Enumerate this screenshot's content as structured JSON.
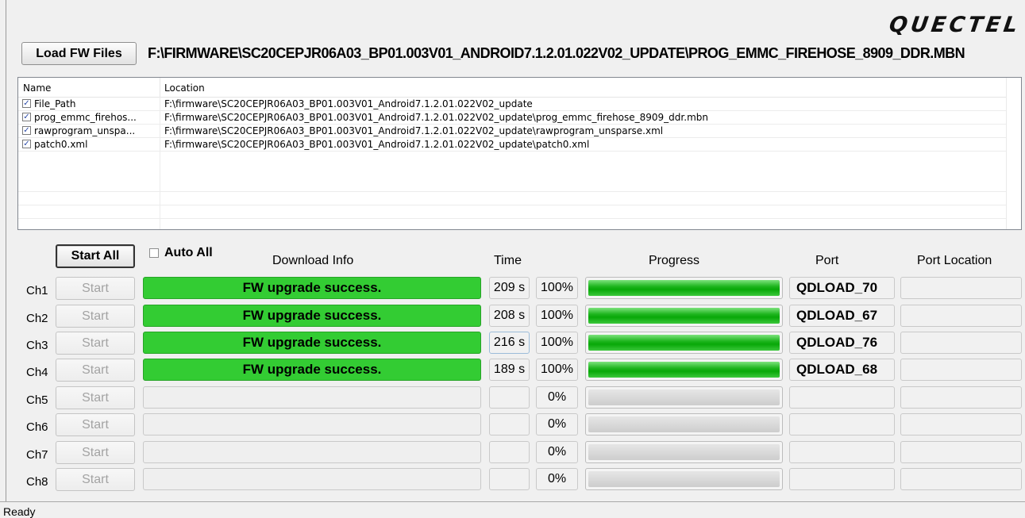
{
  "brand": {
    "logo_text": "QUECTEL"
  },
  "toolbar": {
    "load_label": "Load FW Files",
    "fw_path": "F:\\FIRMWARE\\SC20CEPJR06A03_BP01.003V01_ANDROID7.1.2.01.022V02_UPDATE\\PROG_EMMC_FIREHOSE_8909_DDR.MBN"
  },
  "file_list": {
    "columns": [
      "Name",
      "Location"
    ],
    "rows": [
      {
        "checked": true,
        "name": "File_Path",
        "location": "F:\\firmware\\SC20CEPJR06A03_BP01.003V01_Android7.1.2.01.022V02_update"
      },
      {
        "checked": true,
        "name": "prog_emmc_firehos...",
        "location": "F:\\firmware\\SC20CEPJR06A03_BP01.003V01_Android7.1.2.01.022V02_update\\prog_emmc_firehose_8909_ddr.mbn"
      },
      {
        "checked": true,
        "name": "rawprogram_unspa...",
        "location": "F:\\firmware\\SC20CEPJR06A03_BP01.003V01_Android7.1.2.01.022V02_update\\rawprogram_unsparse.xml"
      },
      {
        "checked": true,
        "name": "patch0.xml",
        "location": "F:\\firmware\\SC20CEPJR06A03_BP01.003V01_Android7.1.2.01.022V02_update\\patch0.xml"
      }
    ]
  },
  "controls": {
    "start_all_label": "Start All",
    "auto_all_label": "Auto All",
    "auto_all_checked": false
  },
  "headers": {
    "download_info": "Download Info",
    "time": "Time",
    "progress": "Progress",
    "port": "Port",
    "port_location": "Port Location"
  },
  "channels": [
    {
      "label": "Ch1",
      "button": "Start",
      "info": "FW upgrade success.",
      "time": "209 s",
      "percent": "100%",
      "progress": 1.0,
      "port": "QDLOAD_70",
      "port_location": ""
    },
    {
      "label": "Ch2",
      "button": "Start",
      "info": "FW upgrade success.",
      "time": "208 s",
      "percent": "100%",
      "progress": 1.0,
      "port": "QDLOAD_67",
      "port_location": ""
    },
    {
      "label": "Ch3",
      "button": "Start",
      "info": "FW upgrade success.",
      "time": "216 s",
      "percent": "100%",
      "progress": 1.0,
      "port": "QDLOAD_76",
      "port_location": ""
    },
    {
      "label": "Ch4",
      "button": "Start",
      "info": "FW upgrade success.",
      "time": "189 s",
      "percent": "100%",
      "progress": 1.0,
      "port": "QDLOAD_68",
      "port_location": ""
    },
    {
      "label": "Ch5",
      "button": "Start",
      "info": "",
      "time": "",
      "percent": "0%",
      "progress": 0.0,
      "port": "",
      "port_location": ""
    },
    {
      "label": "Ch6",
      "button": "Start",
      "info": "",
      "time": "",
      "percent": "0%",
      "progress": 0.0,
      "port": "",
      "port_location": ""
    },
    {
      "label": "Ch7",
      "button": "Start",
      "info": "",
      "time": "",
      "percent": "0%",
      "progress": 0.0,
      "port": "",
      "port_location": ""
    },
    {
      "label": "Ch8",
      "button": "Start",
      "info": "",
      "time": "",
      "percent": "0%",
      "progress": 0.0,
      "port": "",
      "port_location": ""
    }
  ],
  "status": {
    "text": "Ready"
  },
  "colors": {
    "success": "#33cc33",
    "progress_fill": "#12b012"
  }
}
